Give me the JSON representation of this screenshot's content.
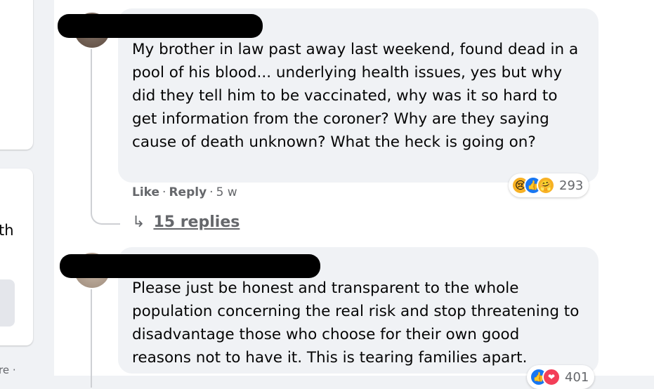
{
  "left_column": {
    "fragment_1": "th",
    "fragment_2": "re ·"
  },
  "comments": [
    {
      "text": "My brother in law past away last weekend, found dead in a pool of his blood... underlying health issues, yes but why did they tell him to be vaccinated, why was it so hard to get information from the coroner? Why are they saying cause of death unknown? What the heck is going on?",
      "like_label": "Like",
      "reply_label": "Reply",
      "time": "5 w",
      "separator": "·",
      "reactions": [
        "sad-icon",
        "like-icon",
        "care-icon"
      ],
      "reaction_count": "293",
      "replies_label": "15 replies"
    },
    {
      "text": "Please just be honest and transparent to the whole population concerning the real risk and stop threatening to disadvantage those who choose for their own good reasons not to have it. This is tearing families apart.",
      "reactions": [
        "like-icon",
        "love-icon"
      ],
      "reaction_count": "401"
    }
  ]
}
